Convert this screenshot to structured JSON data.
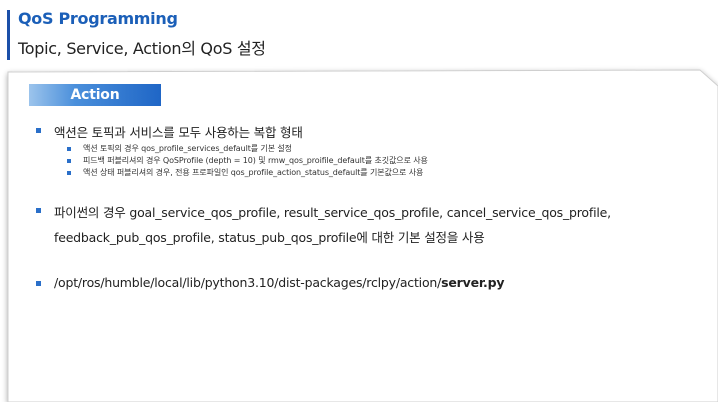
{
  "title": {
    "main": "QoS Programming",
    "sub": "Topic, Service, Action의 QoS 설정"
  },
  "section": {
    "label": "Action"
  },
  "bullets": [
    {
      "text": "액션은 토픽과 서비스를 모두 사용하는 복합 형태",
      "sub": [
        "액션 토픽의 경우 qos_profile_services_default를 기본 설정",
        "피드백 퍼블리셔의 경우 QoSProfile (depth = 10) 및 rmw_qos_proifile_default를 초깃값으로 사용",
        "액션 상태 퍼블리셔의 경우, 전용 프로파일인 qos_profile_action_status_default를 기본값으로 사용"
      ]
    },
    {
      "line1": "파이썬의 경우 goal_service_qos_profile, result_service_qos_profile, cancel_service_qos_profile,",
      "line2": "feedback_pub_qos_profile, status_pub_qos_profile에 대한 기본 설정을 사용"
    },
    {
      "path": "/opt/ros/humble/local/lib/python3.10/dist-packages/rclpy/action/",
      "file": "server.py"
    }
  ],
  "colors": {
    "accent": "#1b5fb8",
    "bullet": "#2a6fc9",
    "tag_gradient_end": "#1f66c6"
  }
}
